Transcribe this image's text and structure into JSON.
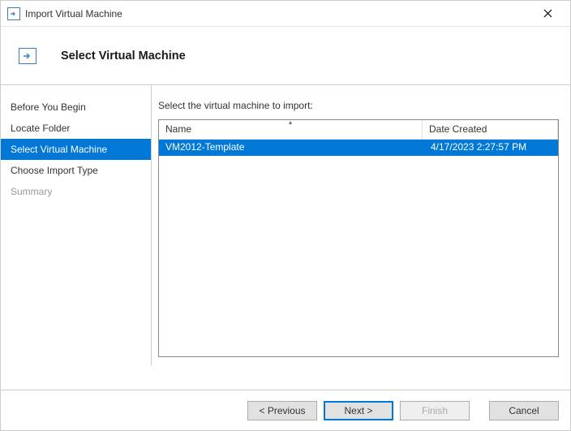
{
  "window": {
    "title": "Import Virtual Machine"
  },
  "header": {
    "title": "Select Virtual Machine"
  },
  "sidebar": {
    "items": [
      {
        "label": "Before You Begin",
        "active": false,
        "disabled": false
      },
      {
        "label": "Locate Folder",
        "active": false,
        "disabled": false
      },
      {
        "label": "Select Virtual Machine",
        "active": true,
        "disabled": false
      },
      {
        "label": "Choose Import Type",
        "active": false,
        "disabled": false
      },
      {
        "label": "Summary",
        "active": false,
        "disabled": true
      }
    ]
  },
  "content": {
    "label": "Select the virtual machine to import:",
    "columns": {
      "name": "Name",
      "date": "Date Created"
    },
    "rows": [
      {
        "name": "VM2012-Template",
        "date": "4/17/2023 2:27:57 PM",
        "selected": true
      }
    ]
  },
  "footer": {
    "previous": "< Previous",
    "next": "Next >",
    "finish": "Finish",
    "cancel": "Cancel"
  }
}
